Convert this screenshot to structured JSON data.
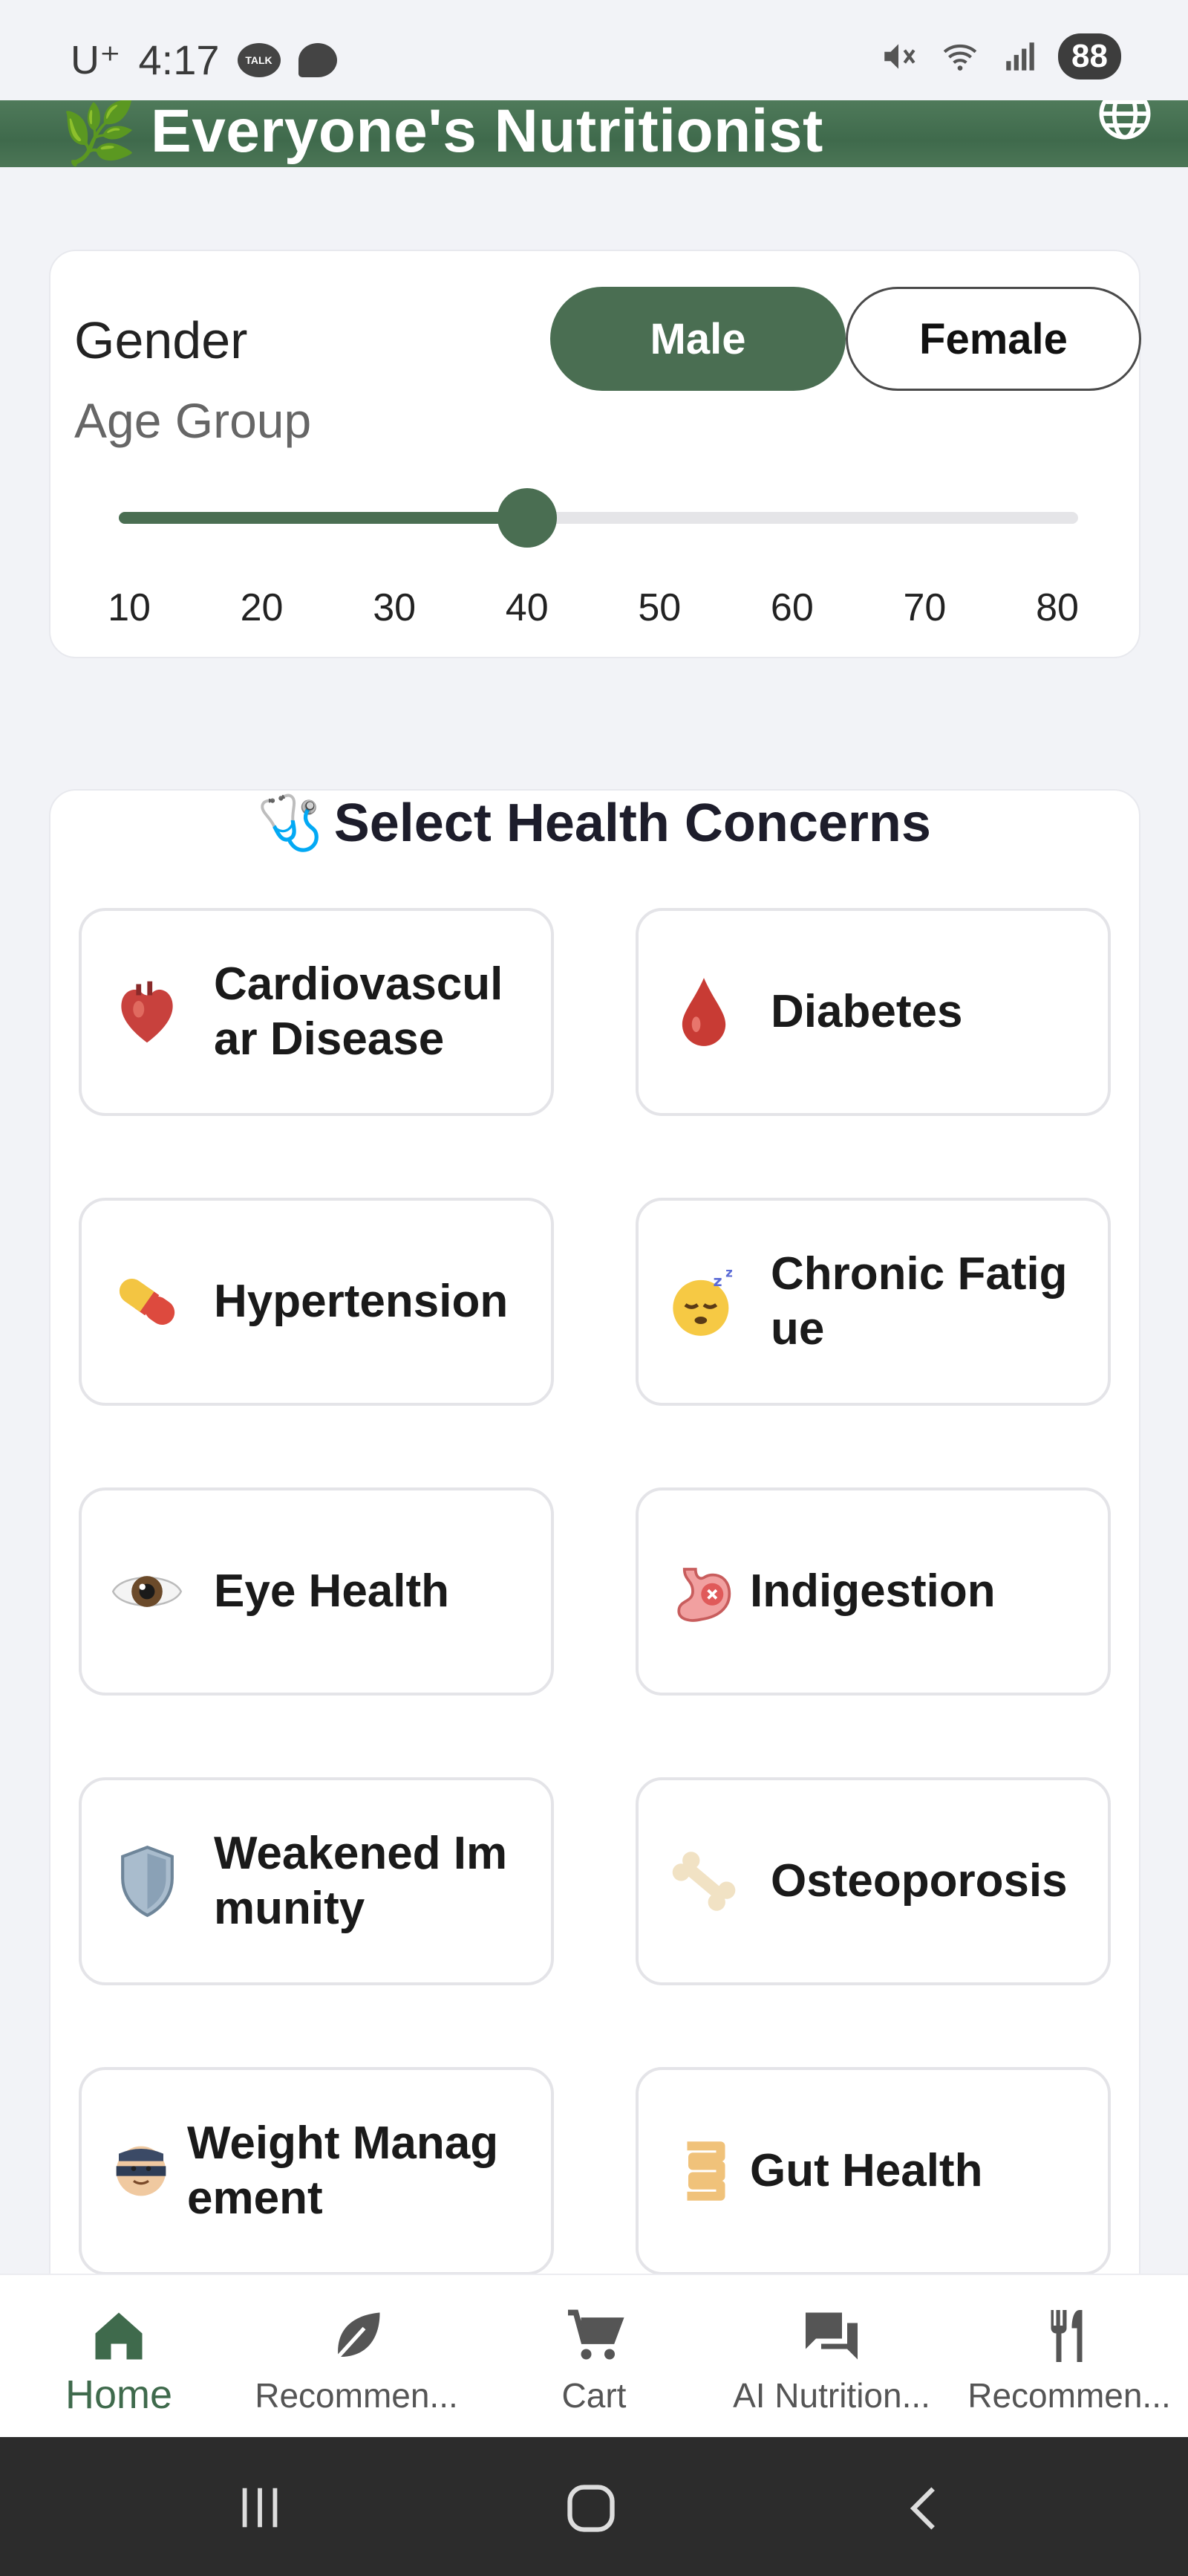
{
  "status_bar": {
    "carrier": "U⁺",
    "time": "4:17",
    "talk_badge": "TALK",
    "battery": "88"
  },
  "header": {
    "title": "Everyone's Nutritionist",
    "leaf_emoji": "🌿",
    "globe_icon": "globe-icon"
  },
  "profile": {
    "gender_label": "Gender",
    "age_label": "Age Group",
    "gender_options": [
      "Male",
      "Female"
    ],
    "selected_gender": "Male",
    "age_ticks": [
      "10",
      "20",
      "30",
      "40",
      "50",
      "60",
      "70",
      "80"
    ],
    "selected_age": 40,
    "age_min": 10,
    "age_max": 80
  },
  "concerns": {
    "title": "Select Health Concerns",
    "title_emoji": "🩺",
    "items": [
      {
        "label": "Cardiovascular Disease",
        "emoji": "🫀"
      },
      {
        "label": "Diabetes",
        "emoji": "🩸"
      },
      {
        "label": "Hypertension",
        "emoji": "💊"
      },
      {
        "label": "Chronic Fatigue",
        "emoji": "😴"
      },
      {
        "label": "Eye Health",
        "emoji": "👁️"
      },
      {
        "label": "Indigestion",
        "emoji": "🤢"
      },
      {
        "label": "Weakened Immunity",
        "emoji": "🛡️"
      },
      {
        "label": "Osteoporosis",
        "emoji": "🦴"
      },
      {
        "label": "Weight Management",
        "emoji": "⚖️"
      },
      {
        "label": "Gut Health",
        "emoji": "🦠"
      }
    ]
  },
  "bottom_nav": {
    "items": [
      {
        "label": "Home",
        "icon": "home-icon",
        "active": true
      },
      {
        "label": "Recommen...",
        "icon": "leaf-icon"
      },
      {
        "label": "Cart",
        "icon": "cart-icon"
      },
      {
        "label": "AI Nutrition...",
        "icon": "chat-icon"
      },
      {
        "label": "Recommen...",
        "icon": "utensils-icon"
      }
    ]
  },
  "colors": {
    "primary": "#4a6e52",
    "header": "#46704f",
    "background": "#f2f3f7"
  }
}
